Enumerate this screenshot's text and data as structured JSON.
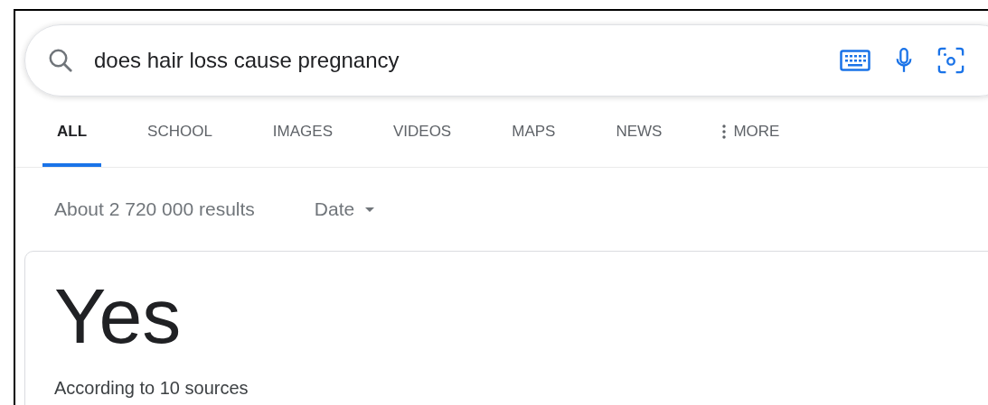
{
  "search": {
    "value": "does hair loss cause pregnancy"
  },
  "tabs": [
    {
      "label": "ALL",
      "selected": true,
      "kind": "plain"
    },
    {
      "label": "SCHOOL",
      "selected": false,
      "kind": "plain"
    },
    {
      "label": "IMAGES",
      "selected": false,
      "kind": "plain"
    },
    {
      "label": "VIDEOS",
      "selected": false,
      "kind": "plain"
    },
    {
      "label": "MAPS",
      "selected": false,
      "kind": "plain"
    },
    {
      "label": "NEWS",
      "selected": false,
      "kind": "plain"
    },
    {
      "label": "MORE",
      "selected": false,
      "kind": "more"
    }
  ],
  "results_count": "About 2 720 000 results",
  "date_filter": "Date",
  "answer": {
    "text": "Yes",
    "source_note": "According to 10 sources"
  }
}
